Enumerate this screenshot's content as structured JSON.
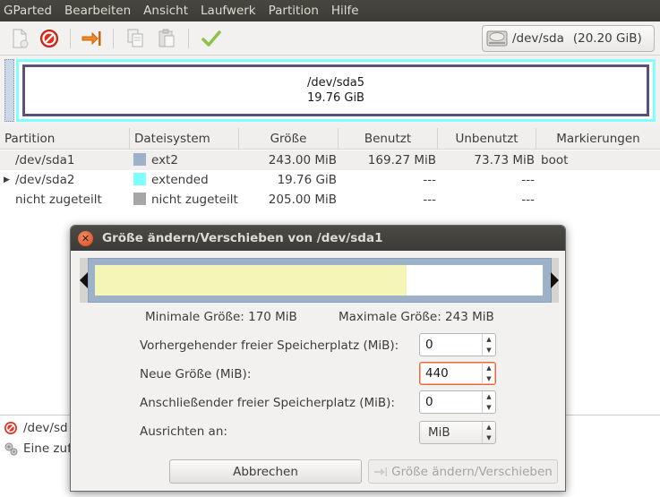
{
  "menu": [
    "GParted",
    "Bearbeiten",
    "Ansicht",
    "Laufwerk",
    "Partition",
    "Hilfe"
  ],
  "toolbar": {
    "device_label": "/dev/sda",
    "device_size": "(20.20 GiB)"
  },
  "graphic": {
    "partition_name": "/dev/sda5",
    "partition_size": "19.76 GiB"
  },
  "table": {
    "headers": [
      "Partition",
      "Dateisystem",
      "Größe",
      "Benutzt",
      "Unbenutzt",
      "Markierungen"
    ],
    "rows": [
      {
        "partition": "/dev/sda1",
        "fs": "ext2",
        "fs_color": "#9db2c9",
        "size": "243.00 MiB",
        "used": "169.27 MiB",
        "unused": "73.73 MiB",
        "flags": "boot"
      },
      {
        "partition": "/dev/sda2",
        "fs": "extended",
        "fs_color": "#7fffff",
        "size": "19.76 GiB",
        "used": "---",
        "unused": "---",
        "flags": ""
      },
      {
        "partition": "nicht zugeteilt",
        "fs": "nicht zugeteilt",
        "fs_color": "#a8a6a4",
        "size": "205.00 MiB",
        "used": "---",
        "unused": "---",
        "flags": ""
      }
    ]
  },
  "operations": {
    "item1": "/dev/sd",
    "item2": "Eine zuf"
  },
  "dialog": {
    "title": "Größe ändern/Verschieben von /dev/sda1",
    "min_size": "Minimale Größe: 170 MiB",
    "max_size": "Maximale Größe: 243 MiB",
    "preceding_label": "Vorhergehender freier Speicherplatz (MiB):",
    "preceding_value": "0",
    "new_size_label": "Neue Größe (MiB):",
    "new_size_value": "440",
    "following_label": "Anschließender freier Speicherplatz (MiB):",
    "following_value": "0",
    "align_label": "Ausrichten an:",
    "align_value": "MiB",
    "cancel": "Abbrechen",
    "apply": "Größe ändern/Verschieben"
  }
}
